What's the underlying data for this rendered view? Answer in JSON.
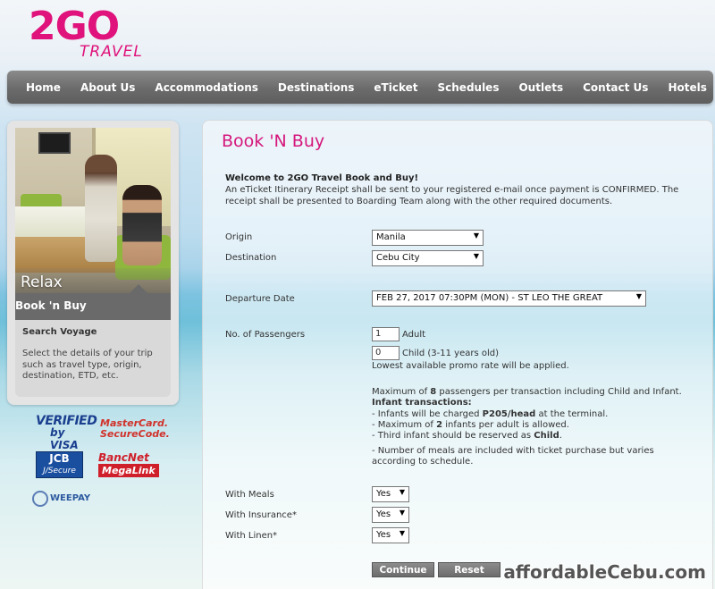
{
  "brand": {
    "logo_main": "2GO",
    "logo_sub": "TRAVEL"
  },
  "nav": {
    "items": [
      {
        "label": "Home"
      },
      {
        "label": "About Us"
      },
      {
        "label": "Accommodations"
      },
      {
        "label": "Destinations"
      },
      {
        "label": "eTicket"
      },
      {
        "label": "Schedules"
      },
      {
        "label": "Outlets"
      },
      {
        "label": "Contact Us"
      },
      {
        "label": "Hotels"
      }
    ]
  },
  "sidebar": {
    "photo_caption": "Relax",
    "banner": "Book 'n Buy",
    "search_title": "Search Voyage",
    "search_desc": "Select the details of your trip such as travel type, origin, destination, ETD, etc."
  },
  "seals": {
    "verified_line1": "VERIFIED",
    "verified_line2": "by VISA",
    "mastercard_line1": "MasterCard.",
    "mastercard_line2": "SecureCode.",
    "jcb_line1": "JCB",
    "jcb_line2": "J/Secure",
    "bancnet_line1": "BancNet",
    "bancnet_line2": "MegaLink",
    "weepay": "WEEPAY"
  },
  "main": {
    "title": "Book 'N Buy",
    "welcome_title": "Welcome to 2GO Travel Book and Buy!",
    "welcome_text": "An eTicket Itinerary Receipt shall be sent to your registered e-mail once payment is CONFIRMED. The receipt shall be presented to Boarding Team along with the other required documents.",
    "origin": {
      "label": "Origin",
      "value": "Manila"
    },
    "destination": {
      "label": "Destination",
      "value": "Cebu City"
    },
    "departure": {
      "label": "Departure Date",
      "value": "FEB 27, 2017 07:30PM (MON) - ST LEO THE GREAT"
    },
    "passengers": {
      "label": "No. of Passengers",
      "adult_value": "1",
      "adult_label": "Adult",
      "child_value": "0",
      "child_label": "Child (3-11 years old)",
      "promo_note": "Lowest available promo rate will be applied."
    },
    "notes": {
      "max_pre": "Maximum of ",
      "max_num": "8",
      "max_post": " passengers per transaction including Child and Infant.",
      "infant_title": "Infant transactions:",
      "infant1_pre": "- Infants will be charged ",
      "infant1_bold": "P205/head",
      "infant1_post": " at the terminal.",
      "infant2_pre": "- Maximum of ",
      "infant2_bold": "2",
      "infant2_post": " infants per adult is allowed.",
      "infant3_pre": "- Third infant should be reserved as ",
      "infant3_bold": "Child",
      "infant3_post": ".",
      "meals_note_1": "- Number of meals are included with ticket purchase but varies",
      "meals_note_2": "according to schedule."
    },
    "meals": {
      "label": "With Meals",
      "value": "Yes"
    },
    "insurance": {
      "label": "With Insurance*",
      "value": "Yes"
    },
    "linen": {
      "label": "With Linen*",
      "value": "Yes"
    },
    "continue_label": "Continue",
    "reset_label": "Reset"
  },
  "watermark": "affordableCebu.com"
}
